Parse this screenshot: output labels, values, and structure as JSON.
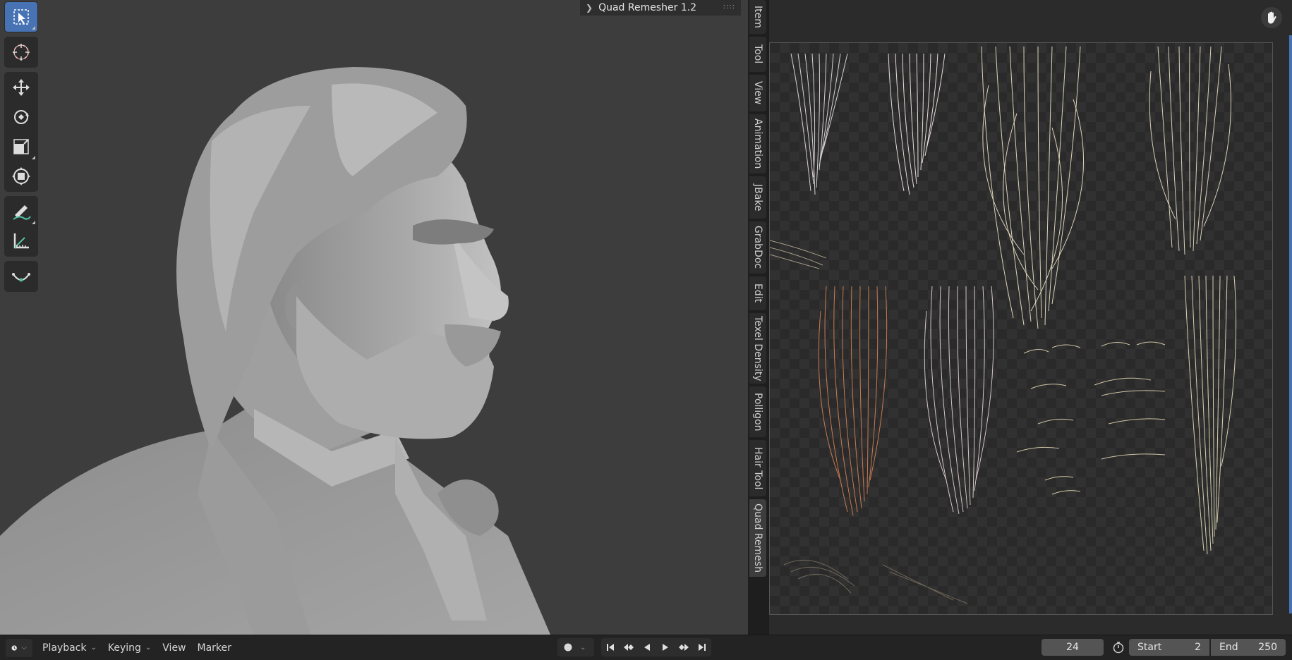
{
  "viewport": {
    "panel_header": {
      "title": "Quad Remesher 1.2"
    },
    "toolbar": [
      [
        "select-box-icon"
      ],
      [
        "cursor-icon"
      ],
      [
        "move-icon",
        "rotate-icon",
        "scale-icon",
        "transform-icon"
      ],
      [
        "annotate-icon",
        "measure-icon"
      ],
      [
        "add-curve-icon"
      ]
    ]
  },
  "sidebar_tabs": [
    "Item",
    "Tool",
    "View",
    "Animation",
    "JBake",
    "GrabDoc",
    "Edit",
    "Texel Density",
    "Polligon",
    "Hair Tool",
    "Quad Remesh"
  ],
  "active_tab": "Quad Remesh",
  "image_editor": {
    "tool_icon": "hand-icon"
  },
  "timeline": {
    "editor_type_icon": "clock-icon",
    "menus": [
      "Playback",
      "Keying",
      "View",
      "Marker"
    ],
    "current_frame": "24",
    "start_label": "Start",
    "start_value": "2",
    "end_label": "End",
    "end_value": "250"
  },
  "colors": {
    "accent": "#4772b3",
    "viewport_bg": "#3d3d3d",
    "header_bg": "#232323"
  }
}
